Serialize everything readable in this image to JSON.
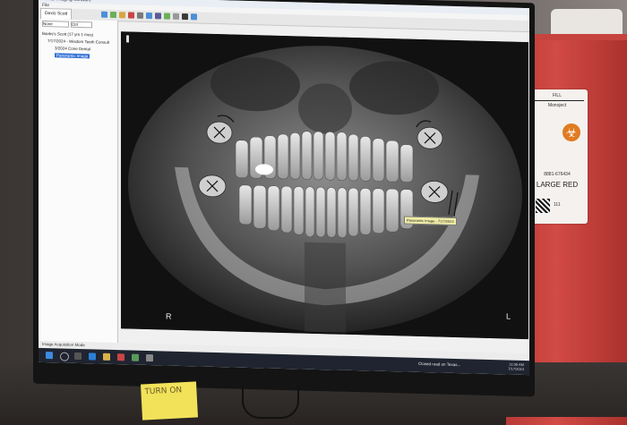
{
  "window": {
    "title": "Dental Imaging Software",
    "menu": "File"
  },
  "toolbar": {
    "tab_label": "Dexis Scott"
  },
  "tree": {
    "combo1": "None",
    "combo2": "Ctrl",
    "items": [
      {
        "label": "Banks's Scott (17 yrs 1 mos)"
      },
      {
        "label": "7/17/2024 - Wisdom Teeth Consult"
      },
      {
        "label": "3/2024 Cone Dental"
      },
      {
        "label": "Panoramic Image"
      }
    ]
  },
  "xray": {
    "corner_left": "R",
    "corner_right": "L",
    "caption": "Panoramic Image - 7/17/2024"
  },
  "status": {
    "text": "Image Acquisition Mode"
  },
  "taskbar": {
    "notification": "Closed road on Texas...",
    "time": "11:05 AM",
    "date": "7/17/2024"
  },
  "sticky_note": {
    "text": "TURN ON"
  },
  "sharps_container": {
    "fill_text": "FILL",
    "brand": "Monoject",
    "size_label": "LARGE RED",
    "part_number": "8881-676434",
    "barcode": "111"
  },
  "colors": {
    "selection": "#2f6fd6",
    "taskbar": "#1f2430",
    "sharps_red": "#c6433e"
  }
}
